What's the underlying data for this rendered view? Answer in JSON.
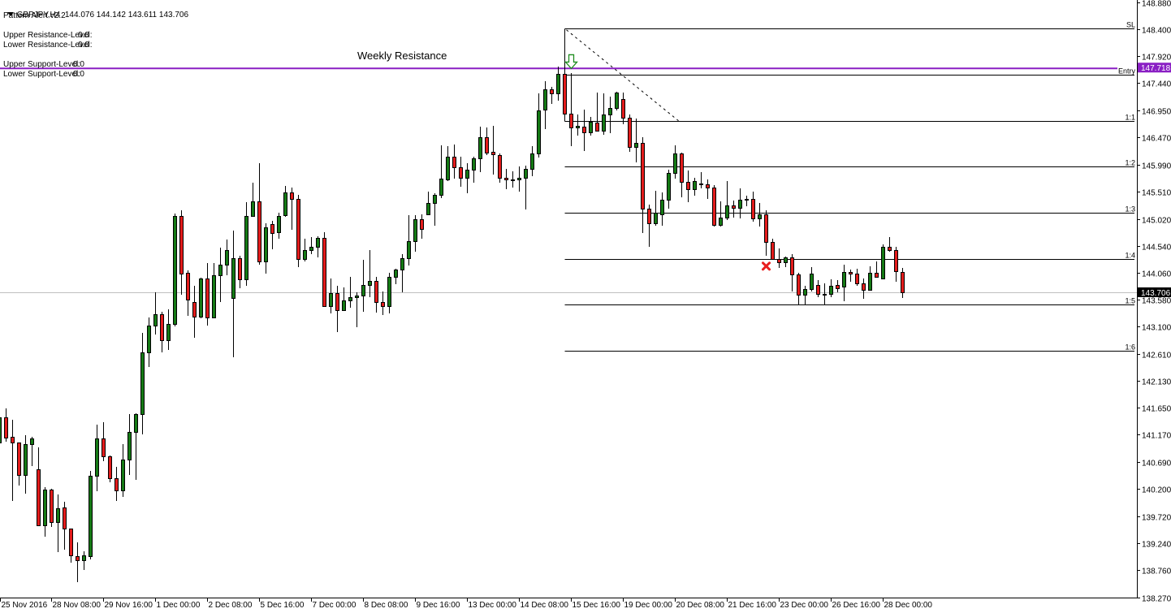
{
  "header": {
    "symbol": "GBPJPY,H4",
    "ohlc": "144.076 144.142 143.611 143.706",
    "indicator": "Pattern Alert v2.2"
  },
  "indicator_levels": [
    {
      "label": "Upper Resistance-Level:",
      "value": "0.0"
    },
    {
      "label": "Lower Resistance-Level:",
      "value": "0.0"
    },
    {
      "label": "Upper Support-Level:",
      "value": "0.0"
    },
    {
      "label": "Lower Support-Level:",
      "value": "0.0"
    }
  ],
  "colors": {
    "bull": "#157a15",
    "bear": "#e31c1c",
    "resistance": "#8a1fc4",
    "current_price_line": "#c0c0c0",
    "signal_arrow": "#1e8c1e",
    "signal_x": "#e81e1e"
  },
  "chart_data": {
    "type": "candlestick",
    "title": "GBPJPY,H4",
    "ylim": [
      138.27,
      148.88
    ],
    "grid": false,
    "y_ticks": [
      "148.880",
      "148.400",
      "147.920",
      "147.440",
      "146.950",
      "146.470",
      "145.990",
      "145.510",
      "145.020",
      "144.540",
      "144.060",
      "143.580",
      "143.100",
      "142.610",
      "142.130",
      "141.650",
      "141.170",
      "140.690",
      "140.200",
      "139.720",
      "139.240",
      "138.760",
      "138.270"
    ],
    "x_ticks": [
      {
        "index": 0,
        "label": "25 Nov 2016"
      },
      {
        "index": 8,
        "label": "28 Nov 08:00"
      },
      {
        "index": 16,
        "label": "29 Nov 16:00"
      },
      {
        "index": 24,
        "label": "1 Dec 00:00"
      },
      {
        "index": 32,
        "label": "2 Dec 08:00"
      },
      {
        "index": 40,
        "label": "5 Dec 16:00"
      },
      {
        "index": 48,
        "label": "7 Dec 00:00"
      },
      {
        "index": 56,
        "label": "8 Dec 08:00"
      },
      {
        "index": 64,
        "label": "9 Dec 16:00"
      },
      {
        "index": 72,
        "label": "13 Dec 00:00"
      },
      {
        "index": 80,
        "label": "14 Dec 08:00"
      },
      {
        "index": 88,
        "label": "15 Dec 16:00"
      },
      {
        "index": 96,
        "label": "19 Dec 00:00"
      },
      {
        "index": 104,
        "label": "20 Dec 08:00"
      },
      {
        "index": 112,
        "label": "21 Dec 16:00"
      },
      {
        "index": 120,
        "label": "23 Dec 00:00"
      },
      {
        "index": 128,
        "label": "26 Dec 16:00"
      },
      {
        "index": 136,
        "label": "28 Dec 00:00"
      }
    ],
    "candles_ohlc": [
      [
        141.03,
        141.61,
        140.99,
        141.48
      ],
      [
        141.48,
        141.64,
        141.05,
        141.12
      ],
      [
        141.13,
        141.44,
        139.99,
        141.03
      ],
      [
        141.03,
        141.03,
        140.26,
        140.45
      ],
      [
        140.45,
        141.16,
        140.12,
        141.0
      ],
      [
        141.0,
        141.13,
        140.61,
        141.1
      ],
      [
        140.55,
        140.94,
        139.54,
        139.55
      ],
      [
        139.55,
        140.23,
        139.35,
        140.19
      ],
      [
        140.19,
        140.21,
        139.53,
        139.61
      ],
      [
        139.61,
        140.11,
        139.08,
        139.86
      ],
      [
        139.87,
        139.97,
        139.12,
        139.5
      ],
      [
        139.5,
        139.5,
        138.89,
        139.02
      ],
      [
        139.0,
        139.25,
        138.54,
        138.93
      ],
      [
        138.93,
        139.09,
        138.76,
        139.02
      ],
      [
        139.0,
        140.52,
        138.95,
        140.44
      ],
      [
        140.44,
        141.35,
        140.16,
        141.1
      ],
      [
        141.1,
        141.39,
        140.7,
        140.79
      ],
      [
        140.79,
        140.8,
        140.32,
        140.39
      ],
      [
        140.39,
        140.6,
        139.99,
        140.18
      ],
      [
        140.18,
        141.0,
        140.06,
        140.73
      ],
      [
        140.73,
        141.54,
        140.45,
        141.22
      ],
      [
        141.22,
        141.55,
        140.37,
        141.54
      ],
      [
        141.54,
        142.99,
        141.18,
        142.64
      ],
      [
        142.64,
        143.26,
        142.38,
        143.12
      ],
      [
        143.12,
        143.71,
        142.96,
        143.32
      ],
      [
        143.32,
        143.36,
        142.64,
        142.86
      ],
      [
        142.86,
        143.41,
        142.68,
        143.15
      ],
      [
        143.15,
        145.11,
        143.1,
        145.07
      ],
      [
        145.07,
        145.17,
        143.67,
        144.04
      ],
      [
        144.06,
        144.1,
        143.29,
        143.58
      ],
      [
        143.54,
        143.83,
        142.9,
        143.28
      ],
      [
        143.28,
        143.97,
        143.25,
        143.96
      ],
      [
        143.96,
        144.23,
        143.12,
        143.26
      ],
      [
        143.26,
        144.23,
        143.25,
        144.01
      ],
      [
        144.01,
        144.51,
        143.54,
        144.2
      ],
      [
        144.2,
        144.65,
        144.01,
        144.46
      ],
      [
        143.61,
        144.81,
        142.55,
        144.32
      ],
      [
        144.32,
        144.36,
        143.78,
        143.94
      ],
      [
        143.94,
        145.32,
        143.83,
        145.07
      ],
      [
        145.07,
        145.67,
        145.06,
        145.33
      ],
      [
        145.33,
        146.01,
        144.2,
        144.26
      ],
      [
        144.26,
        144.94,
        144.04,
        144.87
      ],
      [
        144.93,
        144.98,
        144.48,
        144.77
      ],
      [
        144.78,
        145.13,
        144.67,
        145.07
      ],
      [
        145.09,
        145.61,
        145.06,
        145.49
      ],
      [
        145.49,
        145.58,
        144.83,
        145.38
      ],
      [
        145.38,
        145.45,
        144.16,
        144.3
      ],
      [
        144.3,
        144.67,
        144.26,
        144.46
      ],
      [
        144.46,
        144.7,
        144.39,
        144.52
      ],
      [
        144.52,
        144.71,
        144.33,
        144.68
      ],
      [
        144.68,
        144.78,
        143.45,
        143.46
      ],
      [
        143.46,
        143.96,
        143.33,
        143.7
      ],
      [
        143.7,
        143.83,
        143.0,
        143.39
      ],
      [
        143.39,
        143.8,
        143.38,
        143.57
      ],
      [
        143.57,
        143.99,
        143.44,
        143.62
      ],
      [
        143.62,
        143.71,
        143.09,
        143.65
      ],
      [
        143.65,
        144.29,
        143.36,
        143.84
      ],
      [
        143.84,
        144.46,
        143.62,
        143.91
      ],
      [
        143.91,
        143.99,
        143.35,
        143.54
      ],
      [
        143.54,
        143.72,
        143.3,
        143.46
      ],
      [
        143.46,
        144.06,
        143.33,
        143.99
      ],
      [
        143.99,
        144.13,
        143.86,
        144.12
      ],
      [
        144.12,
        144.39,
        143.71,
        144.32
      ],
      [
        144.32,
        145.09,
        144.19,
        144.62
      ],
      [
        144.62,
        145.09,
        144.43,
        145.01
      ],
      [
        145.01,
        145.1,
        144.67,
        144.84
      ],
      [
        145.1,
        145.51,
        145.09,
        145.3
      ],
      [
        145.3,
        145.48,
        144.9,
        145.45
      ],
      [
        145.45,
        146.33,
        145.39,
        145.74
      ],
      [
        145.72,
        146.32,
        145.69,
        146.13
      ],
      [
        146.13,
        146.35,
        145.74,
        145.94
      ],
      [
        145.94,
        146.13,
        145.59,
        145.75
      ],
      [
        145.75,
        146.01,
        145.48,
        145.9
      ],
      [
        145.9,
        146.13,
        145.67,
        146.1
      ],
      [
        146.1,
        146.66,
        145.85,
        146.48
      ],
      [
        146.48,
        146.65,
        146.16,
        146.2
      ],
      [
        146.22,
        146.68,
        145.81,
        146.17
      ],
      [
        146.16,
        146.19,
        145.67,
        145.75
      ],
      [
        145.75,
        145.91,
        145.55,
        145.72
      ],
      [
        145.72,
        145.87,
        145.58,
        145.72
      ],
      [
        145.72,
        145.95,
        145.51,
        145.75
      ],
      [
        145.75,
        145.97,
        145.19,
        145.91
      ],
      [
        145.91,
        146.32,
        145.78,
        146.19
      ],
      [
        146.19,
        147.26,
        146.11,
        146.95
      ],
      [
        146.97,
        147.47,
        146.62,
        147.33
      ],
      [
        147.33,
        147.37,
        147.07,
        147.26
      ],
      [
        147.26,
        147.74,
        147.13,
        147.61
      ],
      [
        147.61,
        147.74,
        146.87,
        146.9
      ],
      [
        146.9,
        147.62,
        146.32,
        146.65
      ],
      [
        146.65,
        146.88,
        146.5,
        146.68
      ],
      [
        146.66,
        146.97,
        146.23,
        146.56
      ],
      [
        146.56,
        146.84,
        146.5,
        146.75
      ],
      [
        146.74,
        147.27,
        146.58,
        146.59
      ],
      [
        146.59,
        147.26,
        146.52,
        146.88
      ],
      [
        146.88,
        147.2,
        146.55,
        147.0
      ],
      [
        147.0,
        147.29,
        146.95,
        147.27
      ],
      [
        147.16,
        147.27,
        146.71,
        146.82
      ],
      [
        146.82,
        146.88,
        146.21,
        146.3
      ],
      [
        146.3,
        146.81,
        146.03,
        146.37
      ],
      [
        146.37,
        146.48,
        144.77,
        145.2
      ],
      [
        145.2,
        145.27,
        144.52,
        144.94
      ],
      [
        144.94,
        145.52,
        144.9,
        145.13
      ],
      [
        145.1,
        145.49,
        144.9,
        145.36
      ],
      [
        145.36,
        145.9,
        145.2,
        145.84
      ],
      [
        145.84,
        146.33,
        145.74,
        146.19
      ],
      [
        146.19,
        146.2,
        145.4,
        145.68
      ],
      [
        145.68,
        145.88,
        145.32,
        145.55
      ],
      [
        145.55,
        145.75,
        145.43,
        145.69
      ],
      [
        145.64,
        145.85,
        145.56,
        145.65
      ],
      [
        145.64,
        145.72,
        145.38,
        145.58
      ],
      [
        145.58,
        145.62,
        144.88,
        144.91
      ],
      [
        144.91,
        145.33,
        144.88,
        145.04
      ],
      [
        145.04,
        145.69,
        145.0,
        145.26
      ],
      [
        145.26,
        145.35,
        145.04,
        145.22
      ],
      [
        145.22,
        145.56,
        145.03,
        145.36
      ],
      [
        145.38,
        145.43,
        145.25,
        145.36
      ],
      [
        145.38,
        145.51,
        144.97,
        145.03
      ],
      [
        145.03,
        145.3,
        144.88,
        145.1
      ],
      [
        145.1,
        145.17,
        144.36,
        144.61
      ],
      [
        144.61,
        144.67,
        144.29,
        144.3
      ],
      [
        144.3,
        144.49,
        144.14,
        144.25
      ],
      [
        144.25,
        144.35,
        144.16,
        144.33
      ],
      [
        144.33,
        144.39,
        143.72,
        144.03
      ],
      [
        144.03,
        144.06,
        143.49,
        143.67
      ],
      [
        143.67,
        143.83,
        143.49,
        143.77
      ],
      [
        143.77,
        144.16,
        143.72,
        144.04
      ],
      [
        143.84,
        143.93,
        143.62,
        143.68
      ],
      [
        143.68,
        143.87,
        143.49,
        143.68
      ],
      [
        143.68,
        143.94,
        143.62,
        143.83
      ],
      [
        143.84,
        143.93,
        143.71,
        143.78
      ],
      [
        143.81,
        144.2,
        143.55,
        144.07
      ],
      [
        144.07,
        144.11,
        143.9,
        144.04
      ],
      [
        144.04,
        144.13,
        143.83,
        143.87
      ],
      [
        143.87,
        143.96,
        143.59,
        143.75
      ],
      [
        143.75,
        144.17,
        143.74,
        144.06
      ],
      [
        144.06,
        144.26,
        143.97,
        143.99
      ],
      [
        143.96,
        144.56,
        143.94,
        144.52
      ],
      [
        144.52,
        144.7,
        144.43,
        144.46
      ],
      [
        144.46,
        144.52,
        143.9,
        144.09
      ],
      [
        144.076,
        144.142,
        143.611,
        143.706
      ]
    ],
    "current_price": {
      "value": 143.706,
      "label": "143.706"
    },
    "weekly_resistance": {
      "price": 147.718,
      "label": "147.718",
      "text": "Weekly Resistance"
    },
    "trade_levels": {
      "start_index": 87,
      "levels": [
        {
          "name": "SL",
          "price": 148.42
        },
        {
          "name": "Entry",
          "price": 147.59
        },
        {
          "name": "1:1",
          "price": 146.77
        },
        {
          "name": "1:2",
          "price": 145.95
        },
        {
          "name": "1:3",
          "price": 145.13
        },
        {
          "name": "1:4",
          "price": 144.3
        },
        {
          "name": "1:5",
          "price": 143.49
        },
        {
          "name": "1:6",
          "price": 142.67
        }
      ]
    },
    "dashed_trendline": {
      "from": [
        87,
        148.42
      ],
      "to": [
        104.5,
        146.77
      ]
    },
    "sell_arrow": {
      "index": 88,
      "price": 147.86
    },
    "exit_marker": {
      "index": 119,
      "price": 144.22
    }
  }
}
